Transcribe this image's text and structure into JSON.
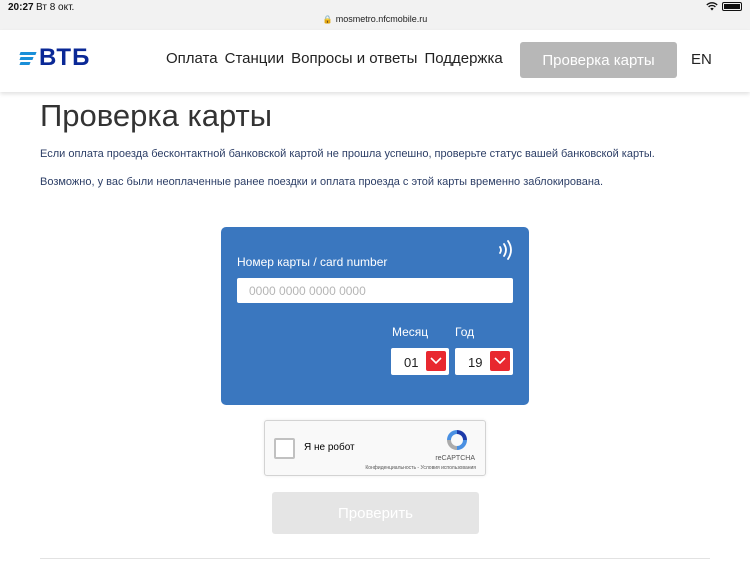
{
  "status_bar": {
    "time": "20:27",
    "date": "Вт 8 окт.",
    "url": "mosmetro.nfcmobile.ru"
  },
  "header": {
    "logo_text": "ВТБ",
    "nav": [
      "Оплата",
      "Станции",
      "Вопросы и ответы",
      "Поддержка"
    ],
    "check_card_button": "Проверка карты",
    "language": "EN"
  },
  "page": {
    "title": "Проверка карты",
    "description_1": "Если оплата проезда бесконтактной банковской картой не прошла успешно, проверьте статус вашей банковской карты.",
    "description_2": "Возможно, у вас были неоплаченные ранее поездки и оплата проезда с этой карты временно заблокирована."
  },
  "card_form": {
    "card_number_label": "Номер карты / card number",
    "card_number_placeholder": "0000 0000 0000 0000",
    "card_number_value": "",
    "month_label": "Месяц",
    "year_label": "Год",
    "month_value": "01",
    "year_value": "19"
  },
  "captcha": {
    "label": "Я не робот",
    "brand": "reCAPTCHA",
    "links": "Конфиденциальность - Условия использования"
  },
  "submit_button": "Проверить",
  "colors": {
    "card_blue": "#3a77bf",
    "select_red": "#e8282f",
    "logo_blue": "#0a2896",
    "logo_accent": "#1a8fd8",
    "disabled_gray": "#b7b7b7"
  },
  "icons": {
    "lock": "lock-icon",
    "wifi": "wifi-icon",
    "battery": "battery-icon",
    "nfc": "contactless-icon",
    "dropdown": "chevron-down-icon",
    "recaptcha": "recaptcha-logo-icon"
  }
}
